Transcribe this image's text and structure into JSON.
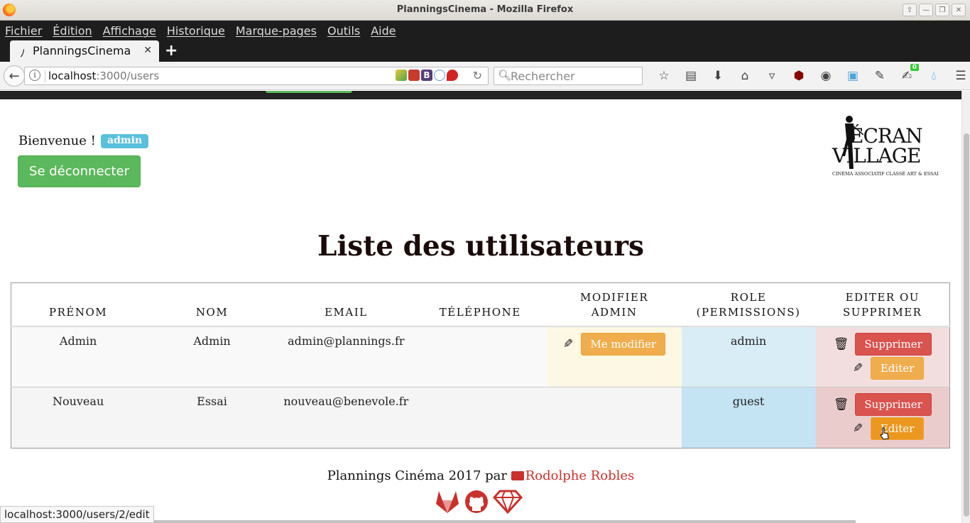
{
  "window": {
    "title": "PlanningsCinema - Mozilla Firefox",
    "buttons": [
      "⇧",
      "—",
      "❐",
      "✕"
    ]
  },
  "menu": [
    "Fichier",
    "Édition",
    "Affichage",
    "Historique",
    "Marque-pages",
    "Outils",
    "Aide"
  ],
  "tab": {
    "title": "PlanningsCinema"
  },
  "urlbar": {
    "host": "localhost",
    "path": ":3000/users"
  },
  "search": {
    "placeholder": "Rechercher"
  },
  "toolbar_icons": [
    "bookmark-star-icon",
    "reading-list-icon",
    "download-icon",
    "home-icon",
    "pocket-icon",
    "ublock-icon",
    "color-wheel-icon",
    "s-addon-icon",
    "pen-addon-icon",
    "notifications-addon-icon",
    "water-drop-icon",
    "hamburger-menu-icon"
  ],
  "addon_badge": "0",
  "page": {
    "welcome": "Bienvenue !",
    "user_badge": "admin",
    "logout_label": "Se déconnecter",
    "logo": {
      "line1": "ÉCRAN",
      "line2": "VILLAGE",
      "tagline": "CINÉMA ASSOCIATIF CLASSÉ ART & ESSAI"
    },
    "heading": "Liste des utilisateurs"
  },
  "table": {
    "headers": [
      "Prénom",
      "Nom",
      "Email",
      "Téléphone",
      "Modifier admin",
      "Role (permissions)",
      "Editer ou supprimer"
    ],
    "rows": [
      {
        "prenom": "Admin",
        "nom": "Admin",
        "email": "admin@plannings.fr",
        "telephone": "",
        "modify_label": "Me modifier",
        "role": "admin",
        "delete_label": "Supprimer",
        "edit_label": "Editer"
      },
      {
        "prenom": "Nouveau",
        "nom": "Essai",
        "email": "nouveau@benevole.fr",
        "telephone": "",
        "modify_label": "",
        "role": "guest",
        "delete_label": "Supprimer",
        "edit_label": "Editer"
      }
    ]
  },
  "footer": {
    "text": "Plannings Cinéma 2017 par",
    "author": "Rodolphe Robles"
  },
  "status": "localhost:3000/users/2/edit",
  "colors": {
    "success": "#5cb85c",
    "warning": "#f0ad4e",
    "danger": "#d9534f",
    "info": "#5bc0de",
    "link": "#c9302c"
  }
}
